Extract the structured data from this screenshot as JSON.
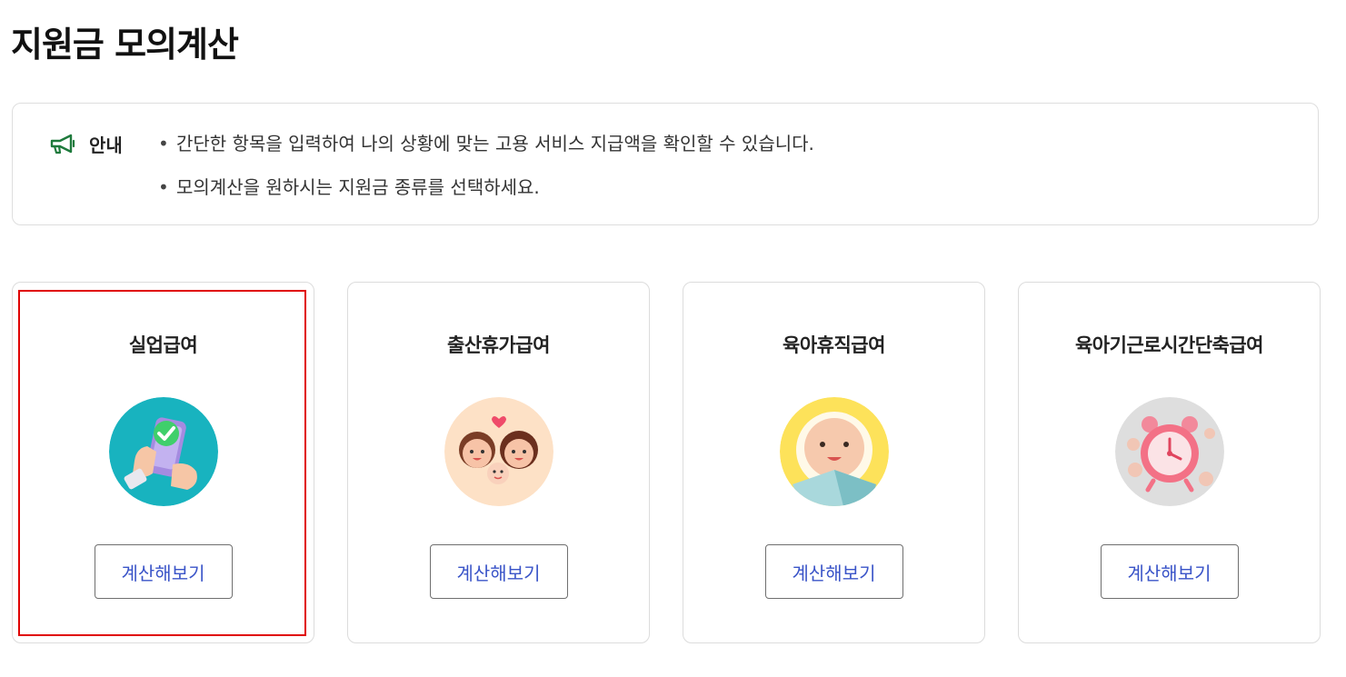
{
  "page": {
    "title": "지원금 모의계산"
  },
  "notice": {
    "label": "안내",
    "icon": "megaphone-icon",
    "accent_color": "#1e7a3c",
    "items": [
      "간단한 항목을 입력하여 나의 상황에 맞는 고용 서비스 지급액을 확인할 수 있습니다.",
      "모의계산을 원하시는 지원금 종류를 선택하세요."
    ]
  },
  "cards": [
    {
      "title": "실업급여",
      "button": "계산해보기",
      "icon": "phone-check-icon",
      "bg": "#18b3bf",
      "selected": true
    },
    {
      "title": "출산휴가급여",
      "button": "계산해보기",
      "icon": "family-icon",
      "bg": "#fde1c6"
    },
    {
      "title": "육아휴직급여",
      "button": "계산해보기",
      "icon": "baby-icon",
      "bg": "#fde25a"
    },
    {
      "title": "육아기근로시간단축급여",
      "button": "계산해보기",
      "icon": "alarm-clock-icon",
      "bg": "#dedede"
    }
  ],
  "selection_color": "#e00000",
  "button_text_color": "#3a54c8"
}
